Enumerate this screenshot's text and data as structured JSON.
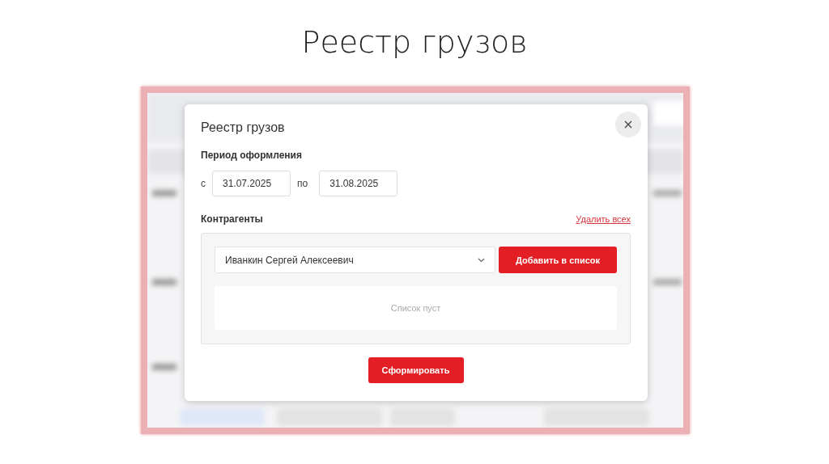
{
  "slide_title": "Реестр грузов",
  "dialog": {
    "title": "Реестр грузов",
    "period": {
      "label": "Период оформления",
      "from_label": "с",
      "from_value": "31.07.2025",
      "to_label": "по",
      "to_value": "31.08.2025"
    },
    "counterparties": {
      "label": "Контрагенты",
      "clear_link": "Удалить всех",
      "selected_value": "Иванкин Сергей Алексеевич",
      "add_button": "Добавить в список",
      "empty_text": "Список пуст"
    },
    "submit_button": "Сформировать"
  }
}
